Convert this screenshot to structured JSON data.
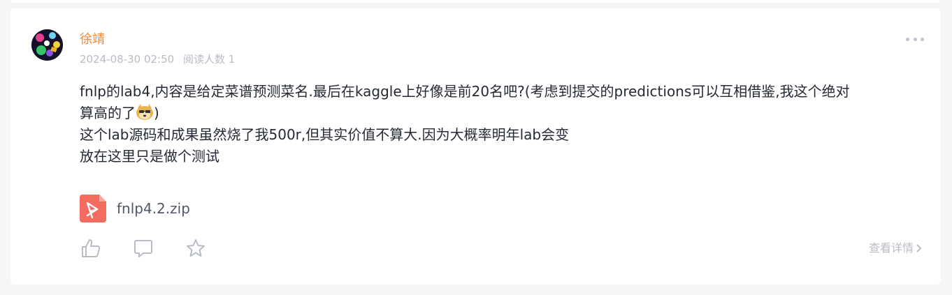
{
  "post": {
    "author": "徐靖",
    "date": "2024-08-30 02:50",
    "read_count": "阅读人数 1",
    "content": {
      "line1": "fnlp的lab4,内容是给定菜谱预测菜名.最后在kaggle上好像是前20名吧?(考虑到提交的predictions可以互相借鉴,我这个绝对",
      "line2": "算高的了",
      "line2_end": ")",
      "line3": "这个lab源码和成果虽然烧了我500r,但其实价值不算大.因为大概率明年lab会变",
      "line4": "放在这里只是做个测试"
    },
    "attachment": {
      "file_name": "fnlp4.2.zip",
      "icon": "pdf-file-icon"
    },
    "actions": {
      "like_icon": "thumbs-up-icon",
      "comment_icon": "comment-icon",
      "favorite_icon": "star-icon"
    },
    "detail_link": "查看详情"
  },
  "colors": {
    "author": "#f08a3c",
    "meta": "#b8bcc4",
    "text": "#252933",
    "file_icon": "#f46b5f",
    "background": "#f5f6f7"
  }
}
